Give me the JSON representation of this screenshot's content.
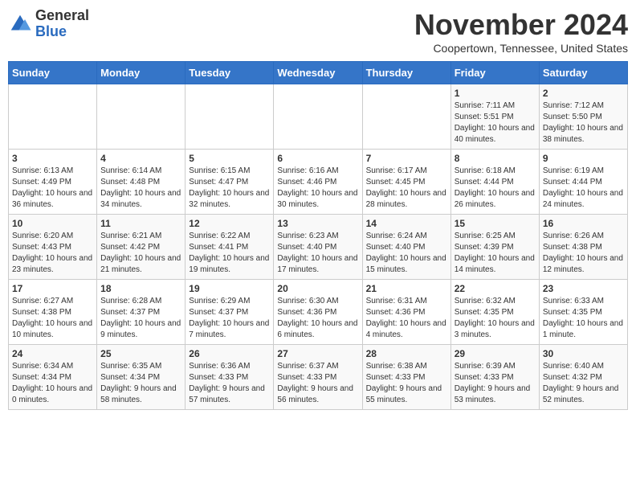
{
  "header": {
    "logo_general": "General",
    "logo_blue": "Blue",
    "title": "November 2024",
    "location": "Coopertown, Tennessee, United States"
  },
  "days_of_week": [
    "Sunday",
    "Monday",
    "Tuesday",
    "Wednesday",
    "Thursday",
    "Friday",
    "Saturday"
  ],
  "weeks": [
    [
      {
        "day": "",
        "info": ""
      },
      {
        "day": "",
        "info": ""
      },
      {
        "day": "",
        "info": ""
      },
      {
        "day": "",
        "info": ""
      },
      {
        "day": "",
        "info": ""
      },
      {
        "day": "1",
        "info": "Sunrise: 7:11 AM\nSunset: 5:51 PM\nDaylight: 10 hours and 40 minutes."
      },
      {
        "day": "2",
        "info": "Sunrise: 7:12 AM\nSunset: 5:50 PM\nDaylight: 10 hours and 38 minutes."
      }
    ],
    [
      {
        "day": "3",
        "info": "Sunrise: 6:13 AM\nSunset: 4:49 PM\nDaylight: 10 hours and 36 minutes."
      },
      {
        "day": "4",
        "info": "Sunrise: 6:14 AM\nSunset: 4:48 PM\nDaylight: 10 hours and 34 minutes."
      },
      {
        "day": "5",
        "info": "Sunrise: 6:15 AM\nSunset: 4:47 PM\nDaylight: 10 hours and 32 minutes."
      },
      {
        "day": "6",
        "info": "Sunrise: 6:16 AM\nSunset: 4:46 PM\nDaylight: 10 hours and 30 minutes."
      },
      {
        "day": "7",
        "info": "Sunrise: 6:17 AM\nSunset: 4:45 PM\nDaylight: 10 hours and 28 minutes."
      },
      {
        "day": "8",
        "info": "Sunrise: 6:18 AM\nSunset: 4:44 PM\nDaylight: 10 hours and 26 minutes."
      },
      {
        "day": "9",
        "info": "Sunrise: 6:19 AM\nSunset: 4:44 PM\nDaylight: 10 hours and 24 minutes."
      }
    ],
    [
      {
        "day": "10",
        "info": "Sunrise: 6:20 AM\nSunset: 4:43 PM\nDaylight: 10 hours and 23 minutes."
      },
      {
        "day": "11",
        "info": "Sunrise: 6:21 AM\nSunset: 4:42 PM\nDaylight: 10 hours and 21 minutes."
      },
      {
        "day": "12",
        "info": "Sunrise: 6:22 AM\nSunset: 4:41 PM\nDaylight: 10 hours and 19 minutes."
      },
      {
        "day": "13",
        "info": "Sunrise: 6:23 AM\nSunset: 4:40 PM\nDaylight: 10 hours and 17 minutes."
      },
      {
        "day": "14",
        "info": "Sunrise: 6:24 AM\nSunset: 4:40 PM\nDaylight: 10 hours and 15 minutes."
      },
      {
        "day": "15",
        "info": "Sunrise: 6:25 AM\nSunset: 4:39 PM\nDaylight: 10 hours and 14 minutes."
      },
      {
        "day": "16",
        "info": "Sunrise: 6:26 AM\nSunset: 4:38 PM\nDaylight: 10 hours and 12 minutes."
      }
    ],
    [
      {
        "day": "17",
        "info": "Sunrise: 6:27 AM\nSunset: 4:38 PM\nDaylight: 10 hours and 10 minutes."
      },
      {
        "day": "18",
        "info": "Sunrise: 6:28 AM\nSunset: 4:37 PM\nDaylight: 10 hours and 9 minutes."
      },
      {
        "day": "19",
        "info": "Sunrise: 6:29 AM\nSunset: 4:37 PM\nDaylight: 10 hours and 7 minutes."
      },
      {
        "day": "20",
        "info": "Sunrise: 6:30 AM\nSunset: 4:36 PM\nDaylight: 10 hours and 6 minutes."
      },
      {
        "day": "21",
        "info": "Sunrise: 6:31 AM\nSunset: 4:36 PM\nDaylight: 10 hours and 4 minutes."
      },
      {
        "day": "22",
        "info": "Sunrise: 6:32 AM\nSunset: 4:35 PM\nDaylight: 10 hours and 3 minutes."
      },
      {
        "day": "23",
        "info": "Sunrise: 6:33 AM\nSunset: 4:35 PM\nDaylight: 10 hours and 1 minute."
      }
    ],
    [
      {
        "day": "24",
        "info": "Sunrise: 6:34 AM\nSunset: 4:34 PM\nDaylight: 10 hours and 0 minutes."
      },
      {
        "day": "25",
        "info": "Sunrise: 6:35 AM\nSunset: 4:34 PM\nDaylight: 9 hours and 58 minutes."
      },
      {
        "day": "26",
        "info": "Sunrise: 6:36 AM\nSunset: 4:33 PM\nDaylight: 9 hours and 57 minutes."
      },
      {
        "day": "27",
        "info": "Sunrise: 6:37 AM\nSunset: 4:33 PM\nDaylight: 9 hours and 56 minutes."
      },
      {
        "day": "28",
        "info": "Sunrise: 6:38 AM\nSunset: 4:33 PM\nDaylight: 9 hours and 55 minutes."
      },
      {
        "day": "29",
        "info": "Sunrise: 6:39 AM\nSunset: 4:33 PM\nDaylight: 9 hours and 53 minutes."
      },
      {
        "day": "30",
        "info": "Sunrise: 6:40 AM\nSunset: 4:32 PM\nDaylight: 9 hours and 52 minutes."
      }
    ]
  ]
}
